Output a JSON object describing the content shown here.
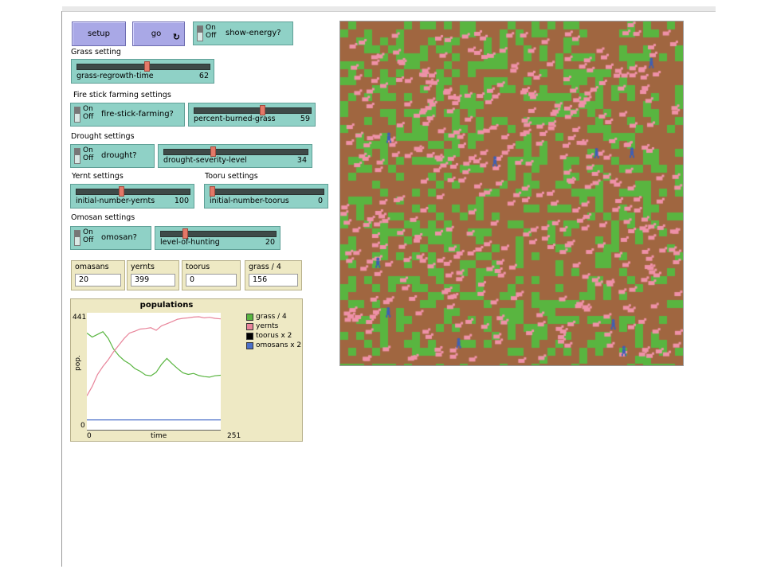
{
  "controls": {
    "setup_label": "setup",
    "go_label": "go",
    "show_energy": {
      "on": "On",
      "off": "Off",
      "label": "show-energy?"
    }
  },
  "sections": {
    "grass": "Grass setting",
    "fire": "Fire stick farming settings",
    "drought": "Drought settings",
    "yernt": "Yernt settings",
    "tooru": "Tooru settings",
    "omosan": "Omosan settings"
  },
  "sliders": {
    "grass_regrowth": {
      "name": "grass-regrowth-time",
      "value": "62",
      "fraction": 0.53
    },
    "percent_burned": {
      "name": "percent-burned-grass",
      "value": "59",
      "fraction": 0.59
    },
    "drought_severity": {
      "name": "drought-severity-level",
      "value": "34",
      "fraction": 0.34
    },
    "initial_yernts": {
      "name": "initial-number-yernts",
      "value": "100",
      "fraction": 0.4
    },
    "initial_toorus": {
      "name": "initial-number-toorus",
      "value": "0",
      "fraction": 0.0
    },
    "level_hunting": {
      "name": "level-of-hunting",
      "value": "20",
      "fraction": 0.2
    }
  },
  "switches": {
    "fire_stick": {
      "on": "On",
      "off": "Off",
      "label": "fire-stick-farming?"
    },
    "drought": {
      "on": "On",
      "off": "Off",
      "label": "drought?"
    },
    "omosan": {
      "on": "On",
      "off": "Off",
      "label": "omosan?"
    }
  },
  "monitors": [
    {
      "label": "omasans",
      "value": "20"
    },
    {
      "label": "yernts",
      "value": "399"
    },
    {
      "label": "toorus",
      "value": "0"
    },
    {
      "label": "grass / 4",
      "value": "156"
    }
  ],
  "plot": {
    "title": "populations",
    "ylabel": "pop.",
    "xlabel": "time",
    "ymax_label": "441",
    "ymin_label": "0",
    "xmin_label": "0",
    "xmax_label": "251",
    "legend": [
      {
        "name": "grass / 4",
        "color": "#59b540"
      },
      {
        "name": "yernts",
        "color": "#e8849a"
      },
      {
        "name": "toorus x 2",
        "color": "#000000"
      },
      {
        "name": "omosans x 2",
        "color": "#4a6fc9"
      }
    ]
  },
  "chart_data": {
    "type": "line",
    "title": "populations",
    "xlabel": "time",
    "ylabel": "pop.",
    "xlim": [
      0,
      251
    ],
    "ylim": [
      0,
      441
    ],
    "grid": false,
    "legend_position": "right",
    "series": [
      {
        "name": "grass / 4",
        "color": "#59b540",
        "x": [
          0,
          10,
          20,
          30,
          40,
          50,
          60,
          70,
          80,
          90,
          100,
          110,
          120,
          130,
          140,
          150,
          160,
          170,
          180,
          190,
          200,
          210,
          220,
          230,
          240,
          251
        ],
        "y": [
          365,
          350,
          360,
          370,
          345,
          305,
          280,
          262,
          250,
          232,
          222,
          208,
          205,
          218,
          248,
          270,
          250,
          232,
          216,
          210,
          214,
          206,
          202,
          200,
          205,
          207
        ]
      },
      {
        "name": "yernts",
        "color": "#e8849a",
        "x": [
          0,
          10,
          20,
          30,
          40,
          50,
          60,
          70,
          80,
          90,
          100,
          110,
          120,
          130,
          140,
          150,
          160,
          170,
          180,
          190,
          200,
          210,
          220,
          230,
          240,
          251
        ],
        "y": [
          130,
          165,
          210,
          240,
          265,
          295,
          320,
          345,
          365,
          372,
          380,
          382,
          385,
          375,
          392,
          400,
          408,
          417,
          420,
          422,
          425,
          426,
          422,
          424,
          420,
          418
        ]
      },
      {
        "name": "toorus x 2",
        "color": "#000000",
        "x": [
          0,
          251
        ],
        "y": [
          0,
          0
        ]
      },
      {
        "name": "omosans x 2",
        "color": "#4a6fc9",
        "x": [
          0,
          251
        ],
        "y": [
          40,
          40
        ]
      }
    ]
  },
  "world": {
    "ground_color": "#a06640",
    "grass_color": "#59b540",
    "sheep_color": "#ef91a8",
    "agent_color": "#3e5fb5",
    "agent_count": 10
  }
}
